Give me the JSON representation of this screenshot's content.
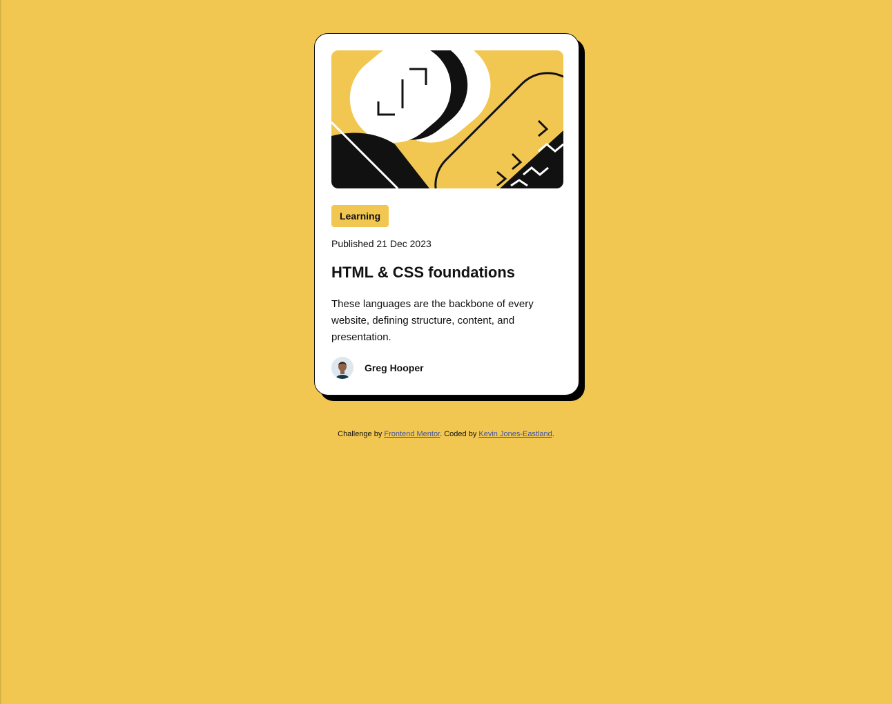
{
  "colors": {
    "page_background": "#f2c751",
    "card_background": "#ffffff",
    "ink": "#111111",
    "link": "#3e52a3"
  },
  "card": {
    "hero_image": {
      "kind": "abstract-illustration"
    },
    "category_badge": "Learning",
    "published": "Published 21 Dec 2023",
    "title": "HTML & CSS foundations",
    "description": "These languages are the backbone of every website, defining structure, content, and presentation.",
    "author": {
      "name": "Greg Hooper",
      "avatar": "author-photo"
    }
  },
  "footer": {
    "prefix": "Challenge by ",
    "challenge_link": "Frontend Mentor",
    "middle": ". Coded by ",
    "coder_link": "Kevin Jones-Eastland",
    "suffix": "."
  }
}
